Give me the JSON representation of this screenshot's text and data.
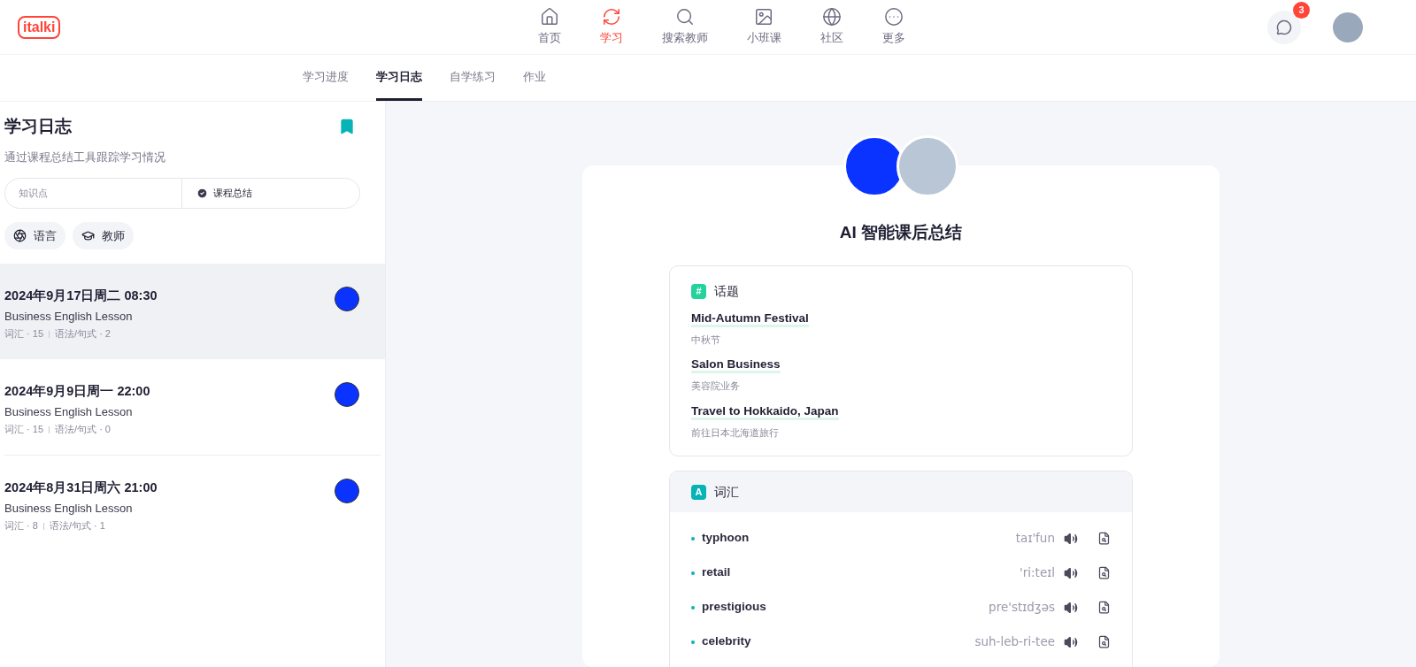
{
  "logo": "italki",
  "nav": [
    {
      "label": "首页",
      "selected": false
    },
    {
      "label": "学习",
      "selected": true
    },
    {
      "label": "搜索教师",
      "selected": false
    },
    {
      "label": "小班课",
      "selected": false
    },
    {
      "label": "社区",
      "selected": false
    },
    {
      "label": "更多",
      "selected": false
    }
  ],
  "messages_badge": "3",
  "sub_tabs": [
    {
      "label": "学习进度",
      "selected": false
    },
    {
      "label": "学习日志",
      "selected": true
    },
    {
      "label": "自学练习",
      "selected": false
    },
    {
      "label": "作业",
      "selected": false
    }
  ],
  "sidebar": {
    "title": "学习日志",
    "subtitle": "通过课程总结工具跟踪学习情况",
    "segments": [
      {
        "label": "知识点",
        "selected": false
      },
      {
        "label": "课程总结",
        "selected": true
      }
    ],
    "filters": [
      {
        "label": "语言"
      },
      {
        "label": "教师"
      }
    ],
    "lessons": [
      {
        "date": "2024年9月17日周二 08:30",
        "title": "Business English Lesson",
        "vocab": "词汇 · 15",
        "grammar": "语法/句式 · 2",
        "selected": true
      },
      {
        "date": "2024年9月9日周一 22:00",
        "title": "Business English Lesson",
        "vocab": "词汇 · 15",
        "grammar": "语法/句式 · 0",
        "selected": false
      },
      {
        "date": "2024年8月31日周六 21:00",
        "title": "Business English Lesson",
        "vocab": "词汇 · 8",
        "grammar": "语法/句式 · 1",
        "selected": false
      }
    ]
  },
  "summary": {
    "title": "AI 智能课后总结",
    "topics": {
      "badge": "#",
      "heading": "话题",
      "items": [
        {
          "en": "Mid-Autumn Festival",
          "zh": "中秋节"
        },
        {
          "en": "Salon Business",
          "zh": "美容院业务"
        },
        {
          "en": "Travel to Hokkaido, Japan",
          "zh": "前往日本北海道旅行"
        }
      ]
    },
    "vocabulary": {
      "badge": "A",
      "heading": "词汇",
      "items": [
        {
          "word": "typhoon",
          "phonetic": "taɪ'fun"
        },
        {
          "word": "retail",
          "phonetic": "'ri:teɪl"
        },
        {
          "word": "prestigious",
          "phonetic": "pre'stɪdʒəs"
        },
        {
          "word": "celebrity",
          "phonetic": "suh-leb-ri-tee"
        }
      ]
    }
  }
}
